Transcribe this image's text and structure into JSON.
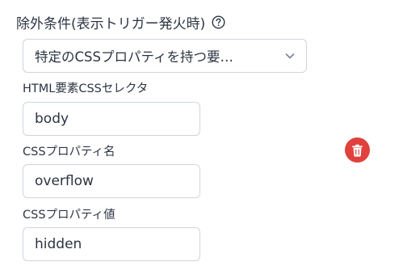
{
  "section": {
    "title": "除外条件(表示トリガー発火時)",
    "help_icon": "question-circle-icon"
  },
  "condition_type": {
    "selected": "特定のCSSプロパティを持つ要…",
    "chevron_icon": "chevron-down-icon"
  },
  "fields": {
    "selector": {
      "label": "HTML要素CSSセレクタ",
      "value": "body"
    },
    "property_name": {
      "label": "CSSプロパティ名",
      "value": "overflow"
    },
    "property_value": {
      "label": "CSSプロパティ値",
      "value": "hidden"
    }
  },
  "delete": {
    "icon": "trash-icon",
    "color": "#e0413c"
  }
}
